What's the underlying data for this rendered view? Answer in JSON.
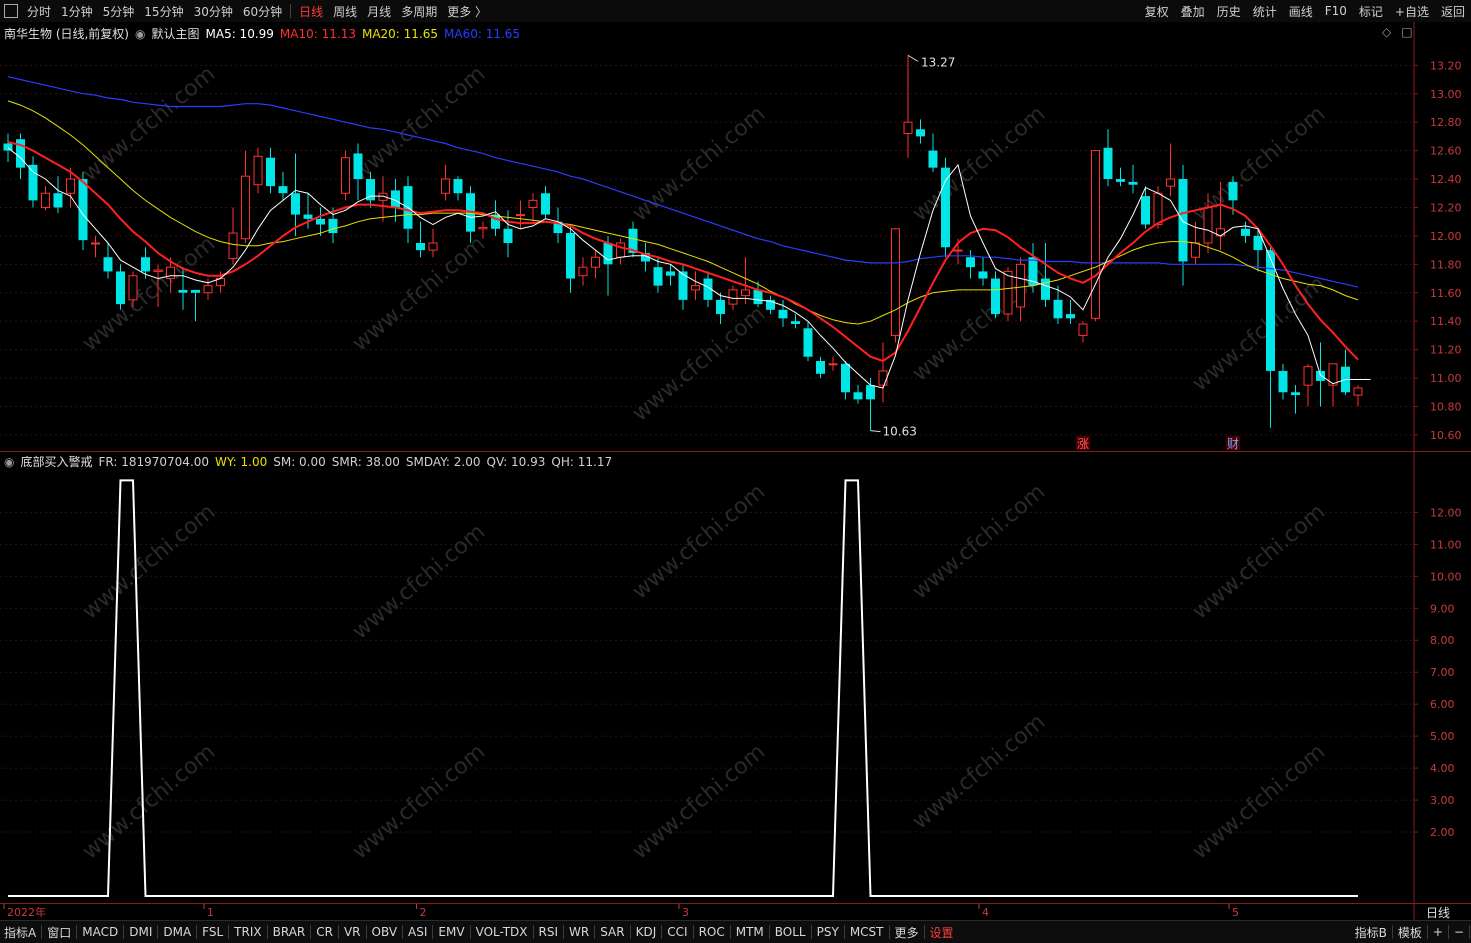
{
  "top_toolbar": {
    "periods": [
      "分时",
      "1分钟",
      "5分钟",
      "15分钟",
      "30分钟",
      "60分钟",
      "日线",
      "周线",
      "月线",
      "多周期",
      "更多 〉"
    ],
    "active_period": "日线",
    "right_tools": [
      "复权",
      "叠加",
      "历史",
      "统计",
      "画线",
      "F10",
      "标记",
      "+自选",
      "返回"
    ]
  },
  "main_chart": {
    "stock_title": "南华生物 (日线,前复权)",
    "template_name": "默认主图",
    "ma_labels": [
      {
        "text": "MA5: 10.99",
        "color": "#ffffff"
      },
      {
        "text": "MA10: 11.13",
        "color": "#ff3030"
      },
      {
        "text": "MA20: 11.65",
        "color": "#e8e000"
      },
      {
        "text": "MA60: 11.65",
        "color": "#2a3cff"
      }
    ],
    "y_ticks": [
      "13.20",
      "13.00",
      "12.80",
      "12.60",
      "12.40",
      "12.20",
      "12.00",
      "11.80",
      "11.60",
      "11.40",
      "11.20",
      "11.00",
      "10.80",
      "10.60"
    ],
    "high_label": "13.27",
    "low_label": "10.63",
    "markers": [
      {
        "text": "涨",
        "index": 86
      },
      {
        "text": "财",
        "index": 98
      }
    ]
  },
  "sub_chart": {
    "indicator_name": "底部买入警戒",
    "params": [
      {
        "text": "FR: 181970704.00",
        "color": "#d0d0d0"
      },
      {
        "text": "WY: 1.00",
        "color": "#e8e000"
      },
      {
        "text": "SM: 0.00",
        "color": "#d0d0d0"
      },
      {
        "text": "SMR: 38.00",
        "color": "#d0d0d0"
      },
      {
        "text": "SMDAY: 2.00",
        "color": "#d0d0d0"
      },
      {
        "text": "QV: 10.93",
        "color": "#d0d0d0"
      },
      {
        "text": "QH: 11.17",
        "color": "#d0d0d0"
      }
    ],
    "y_ticks": [
      "12.00",
      "11.00",
      "10.00",
      "9.00",
      "8.00",
      "7.00",
      "6.00",
      "5.00",
      "4.00",
      "3.00",
      "2.00"
    ]
  },
  "x_axis": {
    "labels": [
      {
        "text": "2022年",
        "index": 0
      },
      {
        "text": "1",
        "index": 16
      },
      {
        "text": "2",
        "index": 33
      },
      {
        "text": "3",
        "index": 54
      },
      {
        "text": "4",
        "index": 78
      },
      {
        "text": "5",
        "index": 98
      }
    ],
    "period_label": "日线"
  },
  "bottom_toolbar": {
    "items": [
      "指标A",
      "窗口",
      "MACD",
      "DMI",
      "DMA",
      "FSL",
      "TRIX",
      "BRAR",
      "CR",
      "VR",
      "OBV",
      "ASI",
      "EMV",
      "VOL-TDX",
      "RSI",
      "WR",
      "SAR",
      "KDJ",
      "CCI",
      "ROC",
      "MTM",
      "BOLL",
      "PSY",
      "MCST",
      "更多",
      "设置"
    ],
    "right_items": [
      "指标B",
      "模板",
      "+",
      "−"
    ]
  },
  "watermark": "www.cfchi.com",
  "chart_data": [
    {
      "type": "candlestick",
      "title": "南华生物 (日线,前复权)",
      "ylim": [
        10.55,
        13.35
      ],
      "up_color": "#ff3030",
      "down_color": "#00e5e5",
      "ohlc": [
        [
          12.65,
          12.72,
          12.52,
          12.6
        ],
        [
          12.68,
          12.72,
          12.4,
          12.48
        ],
        [
          12.5,
          12.56,
          12.2,
          12.25
        ],
        [
          12.2,
          12.35,
          12.18,
          12.3
        ],
        [
          12.3,
          12.42,
          12.16,
          12.2
        ],
        [
          12.3,
          12.48,
          12.2,
          12.4
        ],
        [
          12.4,
          12.45,
          11.9,
          11.97
        ],
        [
          11.95,
          12.0,
          11.85,
          11.95
        ],
        [
          11.85,
          11.95,
          11.7,
          11.75
        ],
        [
          11.75,
          11.8,
          11.48,
          11.52
        ],
        [
          11.55,
          11.75,
          11.5,
          11.72
        ],
        [
          11.85,
          11.92,
          11.7,
          11.75
        ],
        [
          11.75,
          11.8,
          11.5,
          11.76
        ],
        [
          11.7,
          11.85,
          11.6,
          11.78
        ],
        [
          11.62,
          11.78,
          11.48,
          11.6
        ],
        [
          11.62,
          11.62,
          11.4,
          11.6
        ],
        [
          11.6,
          11.7,
          11.55,
          11.65
        ],
        [
          11.65,
          11.75,
          11.6,
          11.7
        ],
        [
          11.84,
          12.2,
          11.8,
          12.02
        ],
        [
          11.98,
          12.6,
          11.95,
          12.42
        ],
        [
          12.36,
          12.62,
          12.3,
          12.56
        ],
        [
          12.55,
          12.62,
          12.3,
          12.35
        ],
        [
          12.35,
          12.45,
          12.25,
          12.3
        ],
        [
          12.3,
          12.58,
          12.0,
          12.15
        ],
        [
          12.15,
          12.3,
          12.05,
          12.12
        ],
        [
          12.12,
          12.2,
          12.0,
          12.08
        ],
        [
          12.12,
          12.2,
          11.95,
          12.02
        ],
        [
          12.3,
          12.6,
          12.25,
          12.55
        ],
        [
          12.58,
          12.65,
          12.25,
          12.4
        ],
        [
          12.4,
          12.45,
          12.2,
          12.25
        ],
        [
          12.25,
          12.42,
          12.1,
          12.3
        ],
        [
          12.32,
          12.4,
          12.1,
          12.2
        ],
        [
          12.35,
          12.42,
          11.95,
          12.05
        ],
        [
          11.95,
          12.1,
          11.85,
          11.9
        ],
        [
          11.9,
          12.05,
          11.85,
          11.95
        ],
        [
          12.3,
          12.5,
          12.25,
          12.4
        ],
        [
          12.4,
          12.42,
          12.25,
          12.3
        ],
        [
          12.3,
          12.35,
          11.95,
          12.03
        ],
        [
          12.05,
          12.1,
          11.98,
          12.06
        ],
        [
          12.15,
          12.25,
          12.0,
          12.05
        ],
        [
          12.05,
          12.18,
          11.85,
          11.95
        ],
        [
          12.15,
          12.25,
          12.05,
          12.15
        ],
        [
          12.2,
          12.3,
          12.1,
          12.25
        ],
        [
          12.3,
          12.35,
          12.12,
          12.15
        ],
        [
          12.1,
          12.2,
          11.95,
          12.02
        ],
        [
          12.02,
          12.08,
          11.6,
          11.7
        ],
        [
          11.72,
          11.85,
          11.65,
          11.78
        ],
        [
          11.78,
          11.9,
          11.7,
          11.85
        ],
        [
          11.95,
          12.0,
          11.58,
          11.8
        ],
        [
          11.85,
          11.98,
          11.8,
          11.95
        ],
        [
          12.05,
          12.1,
          11.85,
          11.88
        ],
        [
          11.88,
          11.95,
          11.75,
          11.82
        ],
        [
          11.78,
          11.85,
          11.6,
          11.65
        ],
        [
          11.75,
          11.8,
          11.65,
          11.72
        ],
        [
          11.75,
          11.8,
          11.48,
          11.55
        ],
        [
          11.62,
          11.75,
          11.55,
          11.65
        ],
        [
          11.7,
          11.75,
          11.5,
          11.55
        ],
        [
          11.55,
          11.6,
          11.38,
          11.45
        ],
        [
          11.52,
          11.65,
          11.48,
          11.62
        ],
        [
          11.58,
          11.85,
          11.52,
          11.62
        ],
        [
          11.62,
          11.68,
          11.5,
          11.52
        ],
        [
          11.55,
          11.58,
          11.45,
          11.48
        ],
        [
          11.48,
          11.55,
          11.36,
          11.42
        ],
        [
          11.4,
          11.45,
          11.35,
          11.38
        ],
        [
          11.35,
          11.4,
          11.12,
          11.15
        ],
        [
          11.12,
          11.15,
          11.0,
          11.03
        ],
        [
          11.1,
          11.15,
          11.05,
          11.1
        ],
        [
          11.1,
          11.12,
          10.85,
          10.9
        ],
        [
          10.9,
          10.95,
          10.82,
          10.85
        ],
        [
          10.95,
          11.0,
          10.63,
          10.85
        ],
        [
          10.95,
          11.25,
          10.83,
          11.05
        ],
        [
          11.3,
          12.05,
          11.25,
          12.05
        ],
        [
          12.72,
          13.27,
          12.55,
          12.8
        ],
        [
          12.75,
          12.82,
          12.65,
          12.7
        ],
        [
          12.6,
          12.72,
          12.45,
          12.48
        ],
        [
          12.48,
          12.55,
          11.85,
          11.92
        ],
        [
          11.9,
          11.98,
          11.8,
          11.9
        ],
        [
          11.85,
          11.9,
          11.7,
          11.78
        ],
        [
          11.75,
          11.85,
          11.65,
          11.7
        ],
        [
          11.7,
          11.75,
          11.42,
          11.45
        ],
        [
          11.45,
          11.78,
          11.4,
          11.75
        ],
        [
          11.5,
          11.85,
          11.4,
          11.8
        ],
        [
          11.85,
          11.95,
          11.6,
          11.65
        ],
        [
          11.7,
          11.95,
          11.5,
          11.55
        ],
        [
          11.55,
          11.65,
          11.38,
          11.42
        ],
        [
          11.45,
          11.55,
          11.38,
          11.42
        ],
        [
          11.3,
          11.4,
          11.25,
          11.38
        ],
        [
          11.42,
          12.6,
          11.4,
          12.6
        ],
        [
          12.62,
          12.75,
          12.35,
          12.4
        ],
        [
          12.4,
          12.48,
          12.35,
          12.38
        ],
        [
          12.38,
          12.5,
          12.3,
          12.36
        ],
        [
          12.28,
          12.35,
          12.05,
          12.08
        ],
        [
          12.08,
          12.35,
          12.05,
          12.3
        ],
        [
          12.35,
          12.65,
          12.28,
          12.4
        ],
        [
          12.4,
          12.5,
          11.65,
          11.82
        ],
        [
          11.85,
          12.1,
          11.8,
          11.95
        ],
        [
          11.95,
          12.3,
          11.88,
          12.2
        ],
        [
          12.0,
          12.38,
          11.9,
          12.05
        ],
        [
          12.38,
          12.42,
          12.15,
          12.25
        ],
        [
          12.05,
          12.1,
          11.95,
          12.0
        ],
        [
          12.0,
          12.05,
          11.75,
          11.9
        ],
        [
          11.9,
          11.92,
          10.65,
          11.05
        ],
        [
          11.05,
          11.1,
          10.85,
          10.9
        ],
        [
          10.9,
          10.95,
          10.75,
          10.88
        ],
        [
          10.95,
          11.1,
          10.8,
          11.08
        ],
        [
          11.05,
          11.25,
          10.8,
          10.98
        ],
        [
          10.95,
          11.1,
          10.8,
          11.1
        ],
        [
          11.08,
          11.2,
          10.88,
          10.9
        ],
        [
          10.88,
          10.95,
          10.8,
          10.93
        ]
      ],
      "ma5": [
        12.62,
        12.55,
        12.45,
        12.4,
        12.32,
        12.28,
        12.15,
        12.05,
        11.95,
        11.83,
        11.78,
        11.73,
        11.7,
        11.72,
        11.72,
        11.69,
        11.67,
        11.7,
        11.78,
        11.9,
        12.05,
        12.18,
        12.25,
        12.32,
        12.3,
        12.22,
        12.15,
        12.18,
        12.24,
        12.28,
        12.28,
        12.25,
        12.2,
        12.13,
        12.08,
        12.13,
        12.16,
        12.13,
        12.14,
        12.17,
        12.08,
        12.05,
        12.07,
        12.12,
        12.1,
        12.05,
        11.97,
        11.9,
        11.83,
        11.85,
        11.86,
        11.86,
        11.82,
        11.8,
        11.73,
        11.68,
        11.64,
        11.58,
        11.56,
        11.56,
        11.55,
        11.54,
        11.51,
        11.46,
        11.4,
        11.3,
        11.21,
        11.11,
        11.03,
        10.95,
        10.93,
        11.16,
        11.55,
        11.88,
        12.18,
        12.39,
        12.5,
        12.14,
        11.95,
        11.77,
        11.72,
        11.7,
        11.68,
        11.65,
        11.62,
        11.57,
        11.48,
        11.66,
        11.85,
        11.98,
        12.15,
        12.34,
        12.3,
        12.25,
        12.1,
        12.06,
        12.04,
        12.0,
        12.06,
        12.07,
        12.05,
        11.84,
        11.63,
        11.45,
        11.3,
        11.02,
        10.96,
        10.99,
        10.99,
        10.99
      ],
      "ma10": [
        12.66,
        12.64,
        12.6,
        12.55,
        12.5,
        12.45,
        12.38,
        12.3,
        12.22,
        12.12,
        12.03,
        11.96,
        11.88,
        11.82,
        11.77,
        11.74,
        11.72,
        11.72,
        11.75,
        11.8,
        11.86,
        11.93,
        12.0,
        12.06,
        12.1,
        12.14,
        12.17,
        12.2,
        12.22,
        12.22,
        12.21,
        12.2,
        12.18,
        12.16,
        12.17,
        12.18,
        12.18,
        12.17,
        12.16,
        12.12,
        12.1,
        12.09,
        12.09,
        12.1,
        12.09,
        12.07,
        12.02,
        11.98,
        11.95,
        11.92,
        11.9,
        11.87,
        11.85,
        11.82,
        11.8,
        11.77,
        11.74,
        11.71,
        11.68,
        11.65,
        11.62,
        11.6,
        11.57,
        11.53,
        11.48,
        11.42,
        11.36,
        11.29,
        11.22,
        11.15,
        11.12,
        11.18,
        11.33,
        11.5,
        11.67,
        11.83,
        11.95,
        12.02,
        12.05,
        12.04,
        11.99,
        11.92,
        11.86,
        11.8,
        11.74,
        11.7,
        11.67,
        11.72,
        11.8,
        11.88,
        11.95,
        12.03,
        12.09,
        12.13,
        12.16,
        12.18,
        12.2,
        12.22,
        12.19,
        12.14,
        12.05,
        11.93,
        11.8,
        11.65,
        11.52,
        11.41,
        11.32,
        11.22,
        11.13
      ],
      "ma20": [
        12.95,
        12.92,
        12.88,
        12.83,
        12.77,
        12.71,
        12.64,
        12.56,
        12.48,
        12.4,
        12.32,
        12.25,
        12.19,
        12.13,
        12.08,
        12.03,
        11.99,
        11.96,
        11.94,
        11.93,
        11.93,
        11.95,
        11.96,
        11.98,
        12.0,
        12.02,
        12.05,
        12.07,
        12.1,
        12.12,
        12.13,
        12.14,
        12.15,
        12.15,
        12.16,
        12.16,
        12.16,
        12.16,
        12.15,
        12.14,
        12.13,
        12.12,
        12.11,
        12.1,
        12.09,
        12.08,
        12.06,
        12.04,
        12.02,
        12.0,
        11.98,
        11.96,
        11.94,
        11.91,
        11.88,
        11.85,
        11.82,
        11.78,
        11.74,
        11.7,
        11.66,
        11.61,
        11.57,
        11.52,
        11.48,
        11.44,
        11.41,
        11.39,
        11.38,
        11.4,
        11.44,
        11.48,
        11.53,
        11.57,
        11.6,
        11.61,
        11.62,
        11.62,
        11.62,
        11.62,
        11.63,
        11.64,
        11.65,
        11.67,
        11.69,
        11.72,
        11.75,
        11.78,
        11.82,
        11.86,
        11.9,
        11.93,
        11.95,
        11.96,
        11.96,
        11.95,
        11.92,
        11.89,
        11.85,
        11.8,
        11.76,
        11.73,
        11.7,
        11.68,
        11.66,
        11.65,
        11.62,
        11.58,
        11.55
      ],
      "ma60": [
        13.12,
        13.1,
        13.08,
        13.06,
        13.04,
        13.02,
        13.0,
        12.99,
        12.97,
        12.96,
        12.94,
        12.93,
        12.92,
        12.91,
        12.91,
        12.91,
        12.91,
        12.91,
        12.92,
        12.93,
        12.93,
        12.92,
        12.9,
        12.88,
        12.86,
        12.84,
        12.82,
        12.8,
        12.78,
        12.76,
        12.75,
        12.73,
        12.71,
        12.69,
        12.67,
        12.65,
        12.62,
        12.6,
        12.58,
        12.55,
        12.53,
        12.51,
        12.49,
        12.47,
        12.45,
        12.42,
        12.4,
        12.37,
        12.34,
        12.31,
        12.28,
        12.25,
        12.22,
        12.19,
        12.16,
        12.13,
        12.1,
        12.07,
        12.04,
        12.01,
        11.98,
        11.96,
        11.93,
        11.91,
        11.89,
        11.87,
        11.85,
        11.83,
        11.82,
        11.81,
        11.81,
        11.81,
        11.82,
        11.84,
        11.85,
        11.86,
        11.86,
        11.86,
        11.85,
        11.85,
        11.84,
        11.83,
        11.83,
        11.82,
        11.82,
        11.82,
        11.81,
        11.81,
        11.81,
        11.81,
        11.81,
        11.81,
        11.81,
        11.8,
        11.8,
        11.8,
        11.8,
        11.8,
        11.8,
        11.79,
        11.78,
        11.77,
        11.76,
        11.74,
        11.72,
        11.7,
        11.68,
        11.66,
        11.64
      ]
    },
    {
      "type": "line",
      "title": "底部买入警戒",
      "ylim": [
        0,
        13.2
      ],
      "color": "#ffffff",
      "baseline": 0,
      "peaks": [
        {
          "rise_start": 8,
          "top_start": 9,
          "top_end": 10,
          "fall_end": 11,
          "value": 13.0
        },
        {
          "rise_start": 66,
          "top_start": 67,
          "top_end": 68,
          "fall_end": 69,
          "value": 13.0
        }
      ],
      "x_count": 111
    }
  ]
}
